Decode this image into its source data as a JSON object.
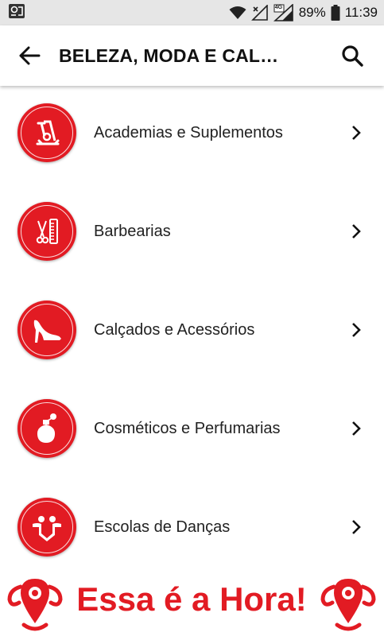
{
  "status_bar": {
    "battery": "89%",
    "time": "11:39",
    "network_label": "4G"
  },
  "app_bar": {
    "title": "BELEZA, MODA E CAL…"
  },
  "categories": [
    {
      "label": "Academias e Suplementos",
      "icon": "exercise-bike-icon"
    },
    {
      "label": "Barbearias",
      "icon": "scissors-comb-icon"
    },
    {
      "label": "Calçados e Acessórios",
      "icon": "high-heel-shoe-icon"
    },
    {
      "label": "Cosméticos e Perfumarias",
      "icon": "perfume-bottle-icon"
    },
    {
      "label": "Escolas de Danças",
      "icon": "dancers-icon"
    }
  ],
  "banner": {
    "text": "Essa é a Hora!"
  },
  "colors": {
    "accent": "#e21b23",
    "status_bar_bg": "#e6e6e6"
  }
}
